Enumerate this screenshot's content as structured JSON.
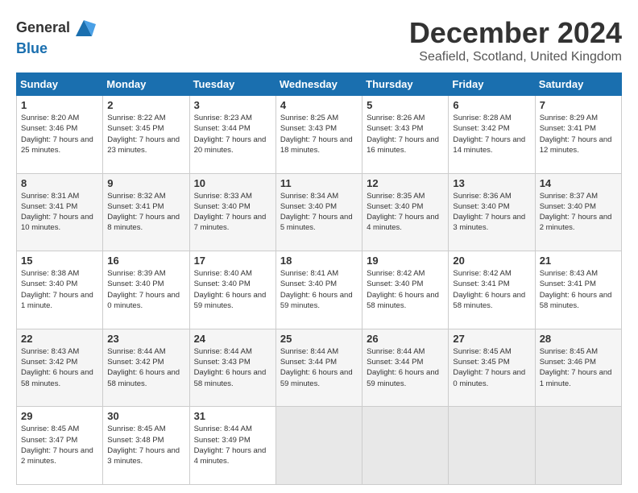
{
  "logo": {
    "line1": "General",
    "line2": "Blue"
  },
  "title": "December 2024",
  "location": "Seafield, Scotland, United Kingdom",
  "days_header": [
    "Sunday",
    "Monday",
    "Tuesday",
    "Wednesday",
    "Thursday",
    "Friday",
    "Saturday"
  ],
  "weeks": [
    [
      {
        "day": "1",
        "sunrise": "8:20 AM",
        "sunset": "3:46 PM",
        "daylight": "7 hours and 25 minutes."
      },
      {
        "day": "2",
        "sunrise": "8:22 AM",
        "sunset": "3:45 PM",
        "daylight": "7 hours and 23 minutes."
      },
      {
        "day": "3",
        "sunrise": "8:23 AM",
        "sunset": "3:44 PM",
        "daylight": "7 hours and 20 minutes."
      },
      {
        "day": "4",
        "sunrise": "8:25 AM",
        "sunset": "3:43 PM",
        "daylight": "7 hours and 18 minutes."
      },
      {
        "day": "5",
        "sunrise": "8:26 AM",
        "sunset": "3:43 PM",
        "daylight": "7 hours and 16 minutes."
      },
      {
        "day": "6",
        "sunrise": "8:28 AM",
        "sunset": "3:42 PM",
        "daylight": "7 hours and 14 minutes."
      },
      {
        "day": "7",
        "sunrise": "8:29 AM",
        "sunset": "3:41 PM",
        "daylight": "7 hours and 12 minutes."
      }
    ],
    [
      {
        "day": "8",
        "sunrise": "8:31 AM",
        "sunset": "3:41 PM",
        "daylight": "7 hours and 10 minutes."
      },
      {
        "day": "9",
        "sunrise": "8:32 AM",
        "sunset": "3:41 PM",
        "daylight": "7 hours and 8 minutes."
      },
      {
        "day": "10",
        "sunrise": "8:33 AM",
        "sunset": "3:40 PM",
        "daylight": "7 hours and 7 minutes."
      },
      {
        "day": "11",
        "sunrise": "8:34 AM",
        "sunset": "3:40 PM",
        "daylight": "7 hours and 5 minutes."
      },
      {
        "day": "12",
        "sunrise": "8:35 AM",
        "sunset": "3:40 PM",
        "daylight": "7 hours and 4 minutes."
      },
      {
        "day": "13",
        "sunrise": "8:36 AM",
        "sunset": "3:40 PM",
        "daylight": "7 hours and 3 minutes."
      },
      {
        "day": "14",
        "sunrise": "8:37 AM",
        "sunset": "3:40 PM",
        "daylight": "7 hours and 2 minutes."
      }
    ],
    [
      {
        "day": "15",
        "sunrise": "8:38 AM",
        "sunset": "3:40 PM",
        "daylight": "7 hours and 1 minute."
      },
      {
        "day": "16",
        "sunrise": "8:39 AM",
        "sunset": "3:40 PM",
        "daylight": "7 hours and 0 minutes."
      },
      {
        "day": "17",
        "sunrise": "8:40 AM",
        "sunset": "3:40 PM",
        "daylight": "6 hours and 59 minutes."
      },
      {
        "day": "18",
        "sunrise": "8:41 AM",
        "sunset": "3:40 PM",
        "daylight": "6 hours and 59 minutes."
      },
      {
        "day": "19",
        "sunrise": "8:42 AM",
        "sunset": "3:40 PM",
        "daylight": "6 hours and 58 minutes."
      },
      {
        "day": "20",
        "sunrise": "8:42 AM",
        "sunset": "3:41 PM",
        "daylight": "6 hours and 58 minutes."
      },
      {
        "day": "21",
        "sunrise": "8:43 AM",
        "sunset": "3:41 PM",
        "daylight": "6 hours and 58 minutes."
      }
    ],
    [
      {
        "day": "22",
        "sunrise": "8:43 AM",
        "sunset": "3:42 PM",
        "daylight": "6 hours and 58 minutes."
      },
      {
        "day": "23",
        "sunrise": "8:44 AM",
        "sunset": "3:42 PM",
        "daylight": "6 hours and 58 minutes."
      },
      {
        "day": "24",
        "sunrise": "8:44 AM",
        "sunset": "3:43 PM",
        "daylight": "6 hours and 58 minutes."
      },
      {
        "day": "25",
        "sunrise": "8:44 AM",
        "sunset": "3:44 PM",
        "daylight": "6 hours and 59 minutes."
      },
      {
        "day": "26",
        "sunrise": "8:44 AM",
        "sunset": "3:44 PM",
        "daylight": "6 hours and 59 minutes."
      },
      {
        "day": "27",
        "sunrise": "8:45 AM",
        "sunset": "3:45 PM",
        "daylight": "7 hours and 0 minutes."
      },
      {
        "day": "28",
        "sunrise": "8:45 AM",
        "sunset": "3:46 PM",
        "daylight": "7 hours and 1 minute."
      }
    ],
    [
      {
        "day": "29",
        "sunrise": "8:45 AM",
        "sunset": "3:47 PM",
        "daylight": "7 hours and 2 minutes."
      },
      {
        "day": "30",
        "sunrise": "8:45 AM",
        "sunset": "3:48 PM",
        "daylight": "7 hours and 3 minutes."
      },
      {
        "day": "31",
        "sunrise": "8:44 AM",
        "sunset": "3:49 PM",
        "daylight": "7 hours and 4 minutes."
      },
      null,
      null,
      null,
      null
    ]
  ]
}
